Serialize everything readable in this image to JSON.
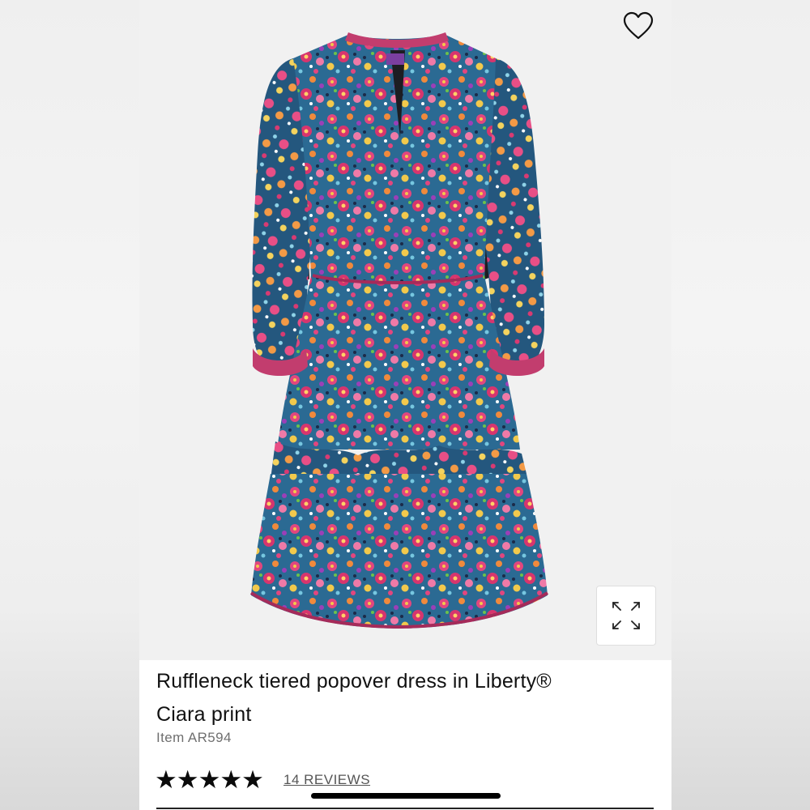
{
  "product": {
    "title_line1": "Ruffleneck tiered popover dress in Liberty®",
    "title_line2": "Ciara print",
    "item_number": "Item AR594",
    "rating_stars": "★★★★★",
    "rating_value": 5,
    "reviews_link": "14 REVIEWS"
  },
  "icons": {
    "wishlist": "heart-outline-icon",
    "expand": "expand-arrows-icon"
  },
  "colors": {
    "dress_base": "#2c6f9a",
    "dress_pink": "#e2467e",
    "dress_orange": "#f08a3c",
    "dress_yellow": "#f2c94c",
    "page_bg": "#f3f3f3"
  }
}
